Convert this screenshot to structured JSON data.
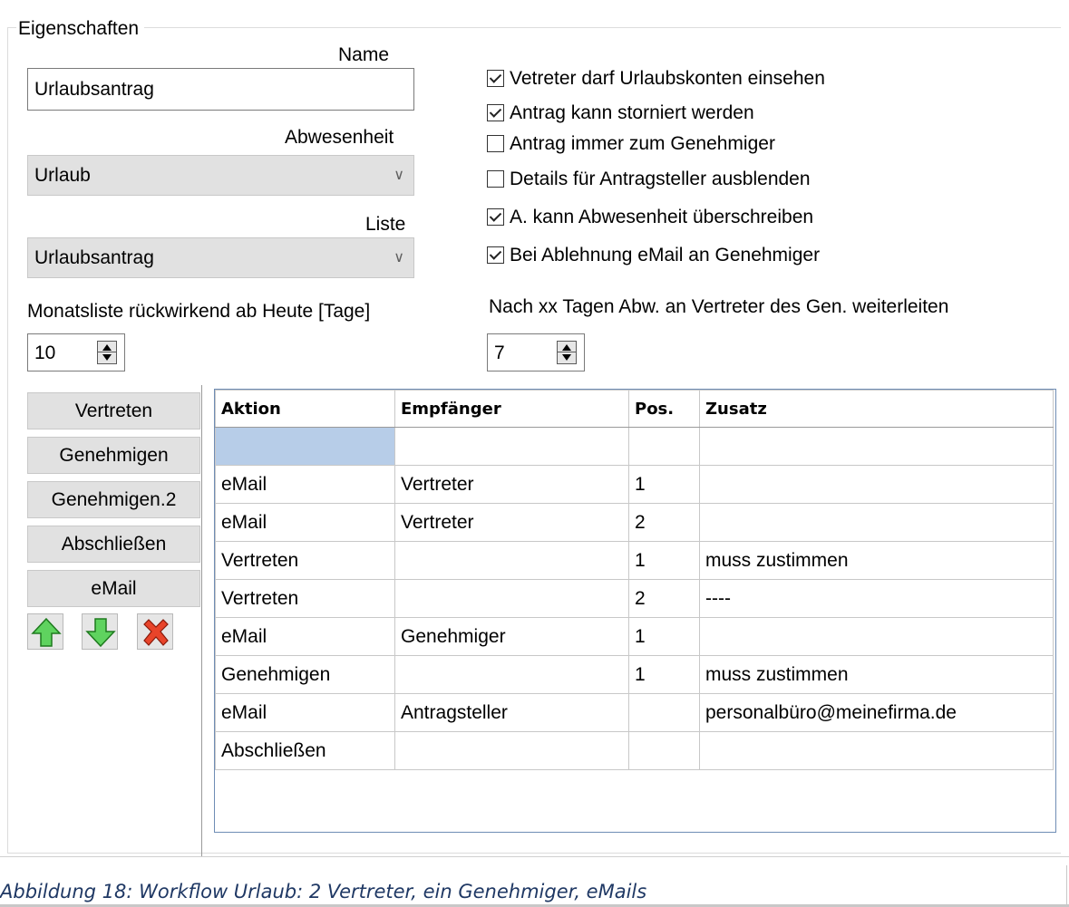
{
  "group": {
    "title": "Eigenschaften"
  },
  "name": {
    "label": "Name",
    "value": "Urlaubsantrag"
  },
  "abwesenheit": {
    "label": "Abwesenheit",
    "value": "Urlaub"
  },
  "liste": {
    "label": "Liste",
    "value": "Urlaubsantrag"
  },
  "monatsliste": {
    "label": "Monatsliste rückwirkend ab Heute [Tage]",
    "value": "10"
  },
  "weiterleiten": {
    "label": "Nach xx Tagen Abw. an Vertreter des Gen. weiterleiten",
    "value": "7"
  },
  "checkboxes": [
    {
      "label": "Vetreter darf Urlaubskonten einsehen",
      "checked": true
    },
    {
      "label": "Antrag kann storniert werden",
      "checked": true
    },
    {
      "label": "Antrag immer zum Genehmiger",
      "checked": false
    },
    {
      "label": "Details für Antragsteller ausblenden",
      "checked": false
    },
    {
      "label": "A. kann Abwesenheit überschreiben",
      "checked": true
    },
    {
      "label": "Bei Ablehnung eMail an Genehmiger",
      "checked": true
    }
  ],
  "sidebar": {
    "buttons": [
      "Vertreten",
      "Genehmigen",
      "Genehmigen.2",
      "Abschließen",
      "eMail"
    ],
    "icons": [
      "arrow-up-icon",
      "arrow-down-icon",
      "delete-icon"
    ]
  },
  "table": {
    "columns": [
      "Aktion",
      "Empfänger",
      "Pos.",
      "Zusatz"
    ],
    "rows": [
      [
        "",
        "",
        "",
        ""
      ],
      [
        "eMail",
        "Vertreter",
        "1",
        ""
      ],
      [
        "eMail",
        "Vertreter",
        "2",
        ""
      ],
      [
        "Vertreten",
        "",
        "1",
        "muss zustimmen"
      ],
      [
        "Vertreten",
        "",
        "2",
        "----"
      ],
      [
        "eMail",
        "Genehmiger",
        "1",
        ""
      ],
      [
        "Genehmigen",
        "",
        "1",
        "muss zustimmen"
      ],
      [
        "eMail",
        "Antragsteller",
        "",
        "personalbüro@meinefirma.de"
      ],
      [
        "Abschließen",
        "",
        "",
        ""
      ]
    ]
  },
  "caption": "Abbildung 18: Workflow Urlaub: 2 Vertreter, ein Genehmiger, eMails",
  "colors": {
    "selected_cell": "#b7cde8",
    "caption_text": "#1f3864",
    "button_bg": "#e1e1e1"
  }
}
